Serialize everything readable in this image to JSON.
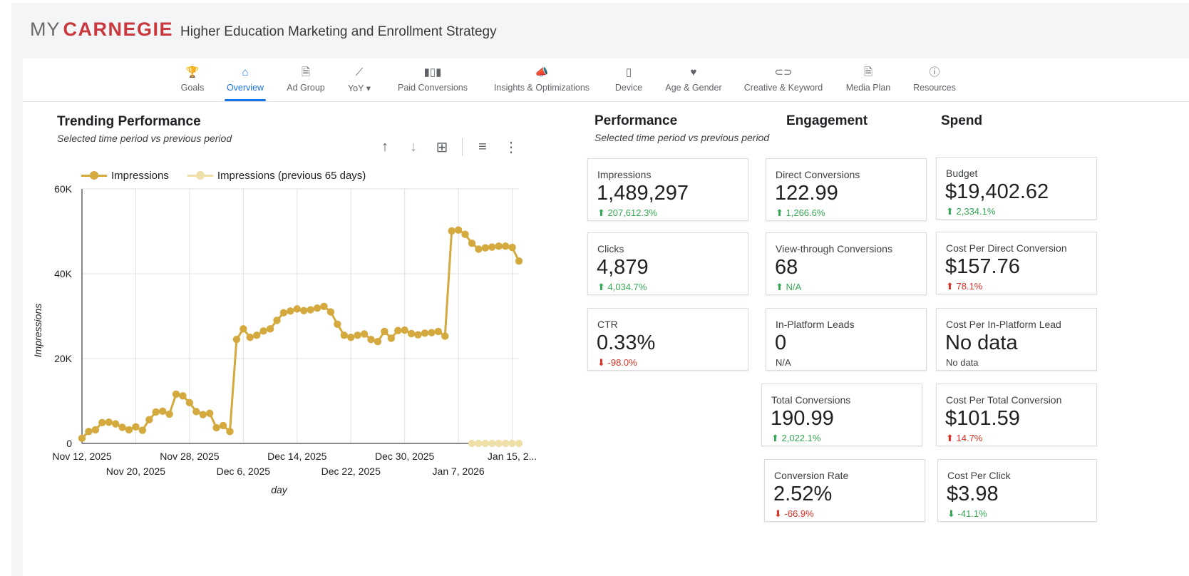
{
  "brand": {
    "my": "MY",
    "carnegie": "CARNEGIE",
    "tagline": "Higher Education Marketing and Enrollment Strategy"
  },
  "tabs": [
    {
      "label": "Goals",
      "icon": "trophy-icon",
      "glyph": "🏆"
    },
    {
      "label": "Overview",
      "icon": "home-icon",
      "glyph": "⌂",
      "active": true
    },
    {
      "label": "Ad Group",
      "icon": "document-icon",
      "glyph": "🗎"
    },
    {
      "label": "YoY ▾",
      "icon": "trend-icon",
      "glyph": "⟋"
    },
    {
      "label": "Paid Conversions",
      "icon": "bar-chart-icon",
      "glyph": "▮▯▮"
    },
    {
      "label": "Insights & Optimizations",
      "icon": "megaphone-icon",
      "glyph": "📣"
    },
    {
      "label": "Device",
      "icon": "phone-icon",
      "glyph": "▯"
    },
    {
      "label": "Age & Gender",
      "icon": "heart-icon",
      "glyph": "♥"
    },
    {
      "label": "Creative & Keyword",
      "icon": "link-icon",
      "glyph": "⊂⊃"
    },
    {
      "label": "Media Plan",
      "icon": "document-icon",
      "glyph": "🗎"
    },
    {
      "label": "Resources",
      "icon": "info-icon",
      "glyph": "ⓘ"
    }
  ],
  "trending": {
    "title": "Trending Performance",
    "subtitle": "Selected time period vs previous period"
  },
  "toolbar": {
    "sort_up": "↑",
    "sort_down": "↓",
    "insights": "⊞",
    "filter": "≡",
    "more": "⋮"
  },
  "performance": {
    "title": "Performance",
    "subtitle": "Selected time period vs previous period"
  },
  "engagement": {
    "title": "Engagement"
  },
  "spend": {
    "title": "Spend"
  },
  "colors": {
    "accent": "#1a73e8",
    "series": "#d4a93e",
    "previous": "#efdfa9",
    "up": "#34a853",
    "down": "#d93025",
    "brand": "#c8383c"
  },
  "cards": {
    "impressions": {
      "label": "Impressions",
      "value": "1,489,297",
      "delta": "⬆ 207,612.3%",
      "dir": "up"
    },
    "clicks": {
      "label": "Clicks",
      "value": "4,879",
      "delta": "⬆ 4,034.7%",
      "dir": "up"
    },
    "ctr": {
      "label": "CTR",
      "value": "0.33%",
      "delta": "⬇ -98.0%",
      "dir": "down"
    },
    "direct_conversions": {
      "label": "Direct Conversions",
      "value": "122.99",
      "delta": "⬆ 1,266.6%",
      "dir": "up"
    },
    "view_through": {
      "label": "View-through Conversions",
      "value": "68",
      "delta": "⬆ N/A",
      "dir": "up"
    },
    "leads": {
      "label": "In-Platform Leads",
      "value": "0",
      "delta": "N/A",
      "dir": "na"
    },
    "total_conversions": {
      "label": "Total Conversions",
      "value": "190.99",
      "delta": "⬆ 2,022.1%",
      "dir": "up"
    },
    "conversion_rate": {
      "label": "Conversion Rate",
      "value": "2.52%",
      "delta": "⬇ -66.9%",
      "dir": "down"
    },
    "budget": {
      "label": "Budget",
      "value": "$19,402.62",
      "delta": "⬆ 2,334.1%",
      "dir": "up"
    },
    "cpdc": {
      "label": "Cost Per Direct Conversion",
      "value": "$157.76",
      "delta": "⬆ 78.1%",
      "dir": "down"
    },
    "cpl": {
      "label": "Cost Per In-Platform Lead",
      "value": "No data",
      "delta": "No data",
      "dir": "na"
    },
    "cptc": {
      "label": "Cost Per Total Conversion",
      "value": "$101.59",
      "delta": "⬆ 14.7%",
      "dir": "down"
    },
    "cpc": {
      "label": "Cost Per Click",
      "value": "$3.98",
      "delta": "⬇ -41.1%",
      "dir": "up"
    }
  },
  "chart_data": {
    "type": "line",
    "xlabel": "day",
    "ylabel": "Impressions",
    "ylim": [
      0,
      60000
    ],
    "y_ticks": [
      0,
      20000,
      40000,
      60000
    ],
    "y_tick_labels": [
      "0",
      "20K",
      "40K",
      "60K"
    ],
    "x_tick_labels": [
      "Nov 12, 2025",
      "Nov 20, 2025",
      "Nov 28, 2025",
      "Dec 6, 2025",
      "Dec 14, 2025",
      "Dec 22, 2025",
      "Dec 30, 2025",
      "Jan 7, 2026",
      "Jan 15, 2..."
    ],
    "x_tick_day_index": [
      0,
      8,
      16,
      24,
      32,
      40,
      48,
      56,
      64
    ],
    "n_days": 65,
    "grid": true,
    "legend_position": "top",
    "series": [
      {
        "name": "Impressions",
        "values": [
          1200,
          2800,
          3200,
          4900,
          5000,
          4600,
          3800,
          3200,
          3900,
          3100,
          5600,
          7400,
          7600,
          6900,
          11600,
          11200,
          9600,
          7500,
          6800,
          7100,
          3700,
          4200,
          2800,
          24500,
          27000,
          25000,
          25500,
          26500,
          27000,
          29000,
          30800,
          31200,
          31700,
          31300,
          31500,
          31900,
          32300,
          31000,
          28100,
          25500,
          25000,
          25500,
          25800,
          24500,
          24000,
          26400,
          24800,
          26600,
          26700,
          25900,
          25600,
          26000,
          26100,
          26400,
          25300,
          50100,
          50300,
          49300,
          47200,
          45800,
          46100,
          46300,
          46500,
          46500,
          46200,
          43000
        ],
        "start_index": 0
      },
      {
        "name": "Impressions (previous 65 days)",
        "values": [
          0,
          0,
          0,
          0,
          0,
          0,
          0,
          0
        ],
        "start_index": 58
      }
    ]
  }
}
